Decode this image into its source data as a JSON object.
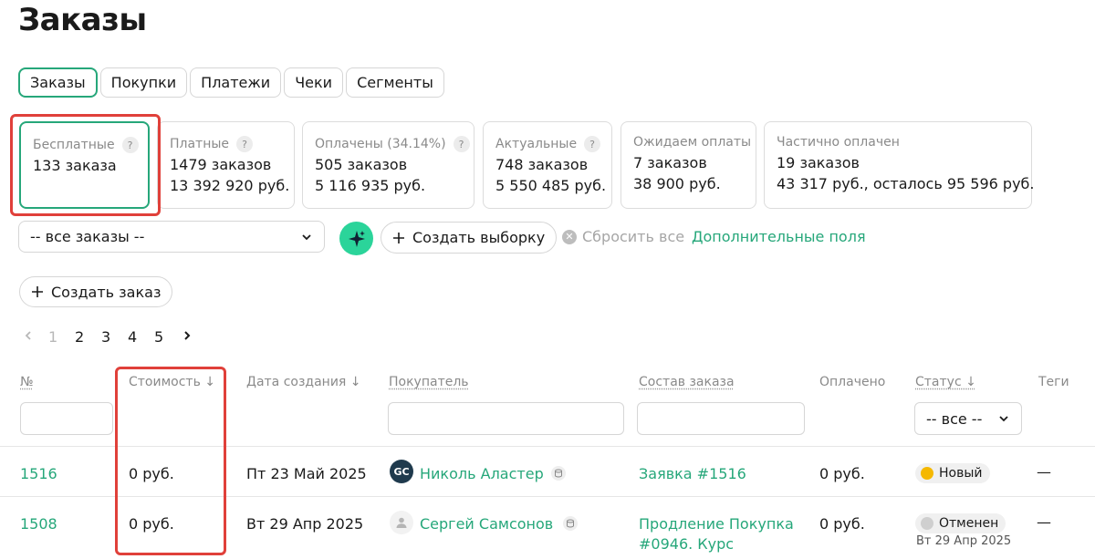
{
  "page_title": "Заказы",
  "tabs": [
    {
      "label": "Заказы"
    },
    {
      "label": "Покупки"
    },
    {
      "label": "Платежи"
    },
    {
      "label": "Чеки"
    },
    {
      "label": "Сегменты"
    }
  ],
  "stats": [
    {
      "title": "Бесплатные",
      "line1": "133 заказа",
      "line2": ""
    },
    {
      "title": "Платные",
      "line1": "1479 заказов",
      "line2": "13 392 920 руб."
    },
    {
      "title": "Оплачены (34.14%)",
      "line1": "505 заказов",
      "line2": "5 116 935 руб."
    },
    {
      "title": "Актуальные",
      "line1": "748 заказов",
      "line2": "5 550 485 руб."
    },
    {
      "title": "Ожидаем оплаты",
      "line1": "7 заказов",
      "line2": "38 900 руб."
    },
    {
      "title": "Частично оплачен",
      "line1": "19 заказов",
      "line2": "43 317 руб., осталось 95 596 руб."
    }
  ],
  "question_mark": "?",
  "filters": {
    "orders_select": "-- все заказы --",
    "create_selection": "Создать выборку",
    "reset_all": "Сбросить все",
    "extra_fields": "Дополнительные поля"
  },
  "create_order": "Создать заказ",
  "pagination": {
    "pages": [
      "1",
      "2",
      "3",
      "4",
      "5"
    ]
  },
  "table": {
    "headers": {
      "num": "№",
      "cost": "Стоимость ↓",
      "created": "Дата создания ↓",
      "buyer": "Покупатель",
      "composition": "Состав заказа",
      "paid": "Оплачено",
      "status": "Статус ↓",
      "tags": "Теги"
    },
    "status_filter": "-- все --",
    "rows": [
      {
        "id": "1516",
        "cost": "0 руб.",
        "created": "Пт 23 Май 2025",
        "avatar_text": "GC",
        "buyer": "Николь Аластер",
        "composition_line1": "Заявка #1516",
        "composition_line2": "",
        "composition_line3": "",
        "paid": "0 руб.",
        "status": "Новый",
        "status_color": "#f5b800",
        "status_date": "",
        "tags": "—"
      },
      {
        "id": "1508",
        "cost": "0 руб.",
        "created": "Вт 29 Апр 2025",
        "avatar_text": "",
        "buyer": "Сергей Самсонов",
        "composition_line1": "Продление Покупка",
        "composition_line2": "#0946. Курс",
        "composition_line3": "",
        "paid": "0 руб.",
        "status": "Отменен",
        "status_color": "#cfcfcf",
        "status_date": "Вт 29 Апр 2025",
        "tags": "—"
      }
    ]
  },
  "colors": {
    "accent": "#26a77a",
    "highlight": "#e0403a",
    "sparkle_bg": "#2bd49a"
  }
}
